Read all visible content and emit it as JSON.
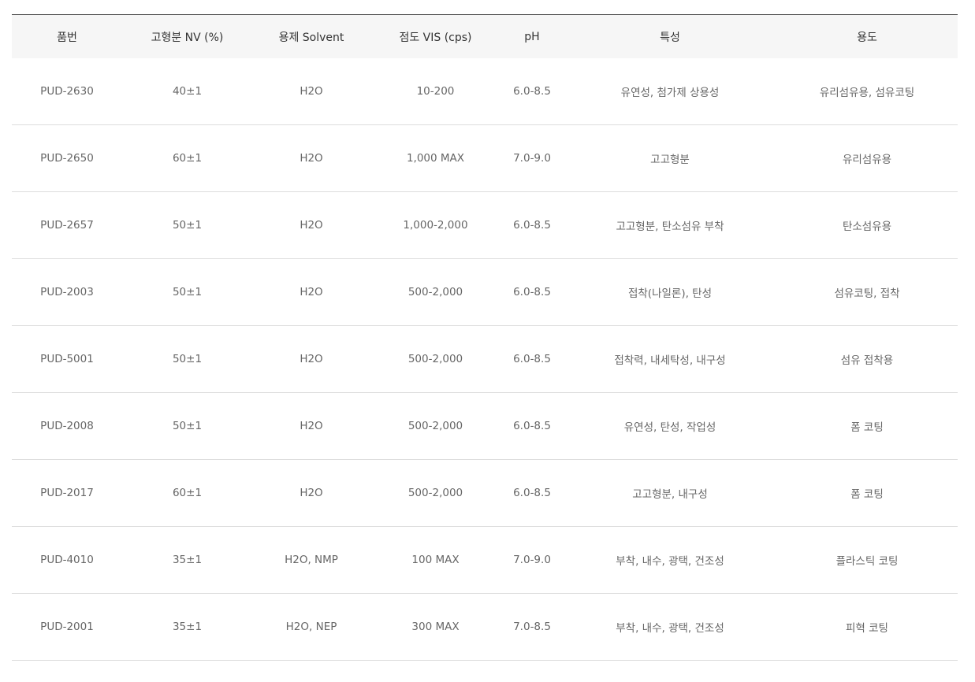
{
  "table": {
    "headers": [
      "품번",
      "고형분 NV (%)",
      "용제 Solvent",
      "점도 VIS (cps)",
      "pH",
      "특성",
      "용도"
    ],
    "rows": [
      [
        "PUD-2630",
        "40±1",
        "H2O",
        "10-200",
        "6.0-8.5",
        "유연성, 첨가제 상용성",
        "유리섬유용, 섬유코팅"
      ],
      [
        "PUD-2650",
        "60±1",
        "H2O",
        "1,000 MAX",
        "7.0-9.0",
        "고고형분",
        "유리섬유용"
      ],
      [
        "PUD-2657",
        "50±1",
        "H2O",
        "1,000-2,000",
        "6.0-8.5",
        "고고형분, 탄소섬유 부착",
        "탄소섬유용"
      ],
      [
        "PUD-2003",
        "50±1",
        "H2O",
        "500-2,000",
        "6.0-8.5",
        "접착(나일론), 탄성",
        "섬유코팅, 접착"
      ],
      [
        "PUD-5001",
        "50±1",
        "H2O",
        "500-2,000",
        "6.0-8.5",
        "접착력, 내세탁성, 내구성",
        "섬유 접착용"
      ],
      [
        "PUD-2008",
        "50±1",
        "H2O",
        "500-2,000",
        "6.0-8.5",
        "유연성, 탄성, 작업성",
        "폼 코팅"
      ],
      [
        "PUD-2017",
        "60±1",
        "H2O",
        "500-2,000",
        "6.0-8.5",
        "고고형분, 내구성",
        "폼 코팅"
      ],
      [
        "PUD-4010",
        "35±1",
        "H2O, NMP",
        "100 MAX",
        "7.0-9.0",
        "부착, 내수, 광택, 건조성",
        "플라스틱 코팅"
      ],
      [
        "PUD-2001",
        "35±1",
        "H2O, NEP",
        "300 MAX",
        "7.0-8.5",
        "부착, 내수, 광택, 건조성",
        "피혁 코팅"
      ]
    ]
  }
}
